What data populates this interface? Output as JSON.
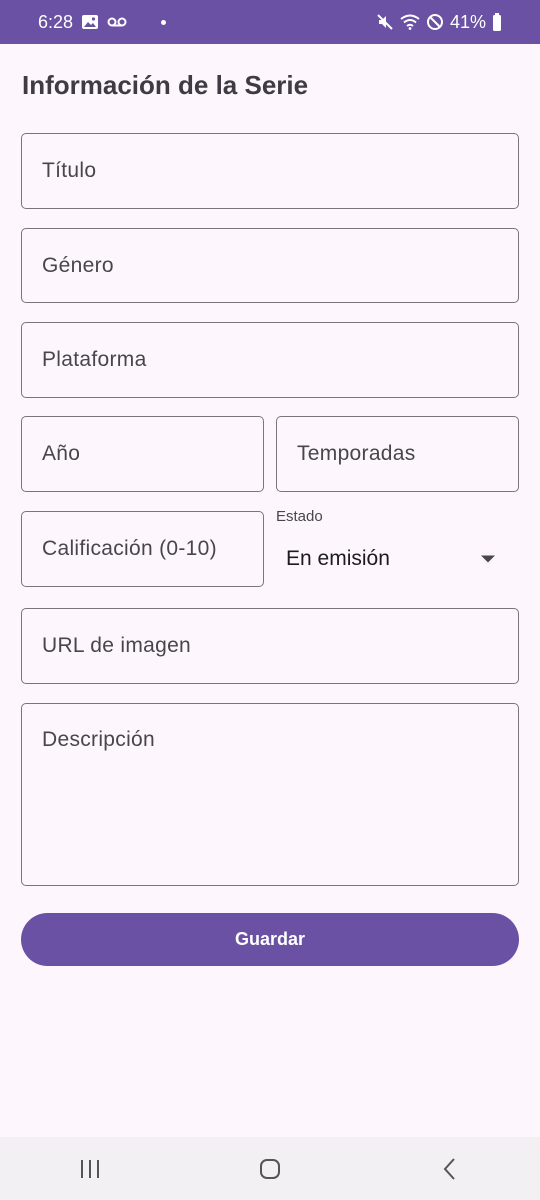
{
  "status_bar": {
    "time": "6:28",
    "battery": "41%",
    "icons": [
      "image-icon",
      "voicemail-icon",
      "notification-dot",
      "mute-icon",
      "wifi-icon",
      "block-icon",
      "battery-icon"
    ]
  },
  "page": {
    "title": "Información de la Serie"
  },
  "form": {
    "titulo_placeholder": "Título",
    "genero_placeholder": "Género",
    "plataforma_placeholder": "Plataforma",
    "anio_placeholder": "Año",
    "temporadas_placeholder": "Temporadas",
    "calificacion_placeholder": "Calificación (0-10)",
    "estado_label": "Estado",
    "estado_value": "En emisión",
    "url_placeholder": "URL de imagen",
    "descripcion_placeholder": "Descripción",
    "save_label": "Guardar"
  },
  "colors": {
    "primary": "#6a51a3",
    "background": "#fdf7fd",
    "outline": "#79747e"
  },
  "nav_bar": {
    "icons": [
      "recents-icon",
      "home-icon",
      "back-icon"
    ]
  }
}
